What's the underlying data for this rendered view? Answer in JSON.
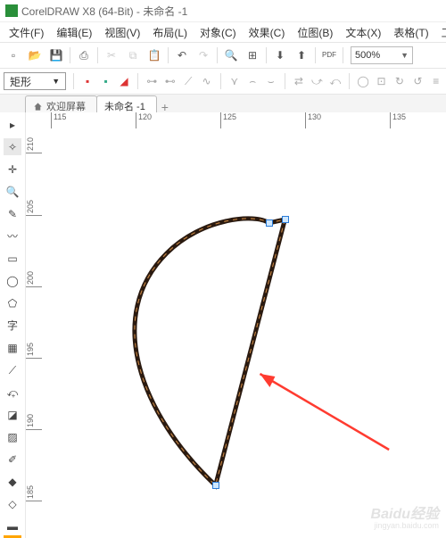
{
  "title": "CorelDRAW X8 (64-Bit) - 未命名 -1",
  "menu": {
    "file": "文件(F)",
    "edit": "编辑(E)",
    "view": "视图(V)",
    "layout": "布局(L)",
    "object": "对象(C)",
    "effect": "效果(C)",
    "bitmap": "位图(B)",
    "text": "文本(X)",
    "table": "表格(T)",
    "tool": "工"
  },
  "zoom": "500%",
  "shape_tool": "矩形",
  "tabs": {
    "welcome": "欢迎屏幕",
    "doc": "未命名 -1"
  },
  "ruler_h": [
    "115",
    "120",
    "125",
    "130",
    "135"
  ],
  "ruler_v": [
    "210",
    "205",
    "200",
    "195",
    "190",
    "185"
  ],
  "toolbar1_icons": [
    "new",
    "open",
    "save",
    "print",
    "cut",
    "copy",
    "paste",
    "undo",
    "redo",
    "search",
    "launch",
    "import",
    "export",
    "pdf"
  ],
  "toolbar2_icons": [
    "align1",
    "align2",
    "sharp",
    "node-add",
    "node-del",
    "reverse",
    "smooth",
    "break",
    "join",
    "symm",
    "cusp",
    "center",
    "line",
    "curve",
    "c-cw",
    "c-ccw",
    "close"
  ],
  "toolbox": [
    "pick",
    "shape",
    "crop",
    "zoom",
    "freehand",
    "artistic",
    "rectangle",
    "ellipse",
    "polygon",
    "text",
    "table",
    "dimension",
    "connector",
    "dropshadow",
    "transparency",
    "eyedropper",
    "fill",
    "outline",
    "interactive"
  ],
  "watermark": {
    "brand": "Baidu经验",
    "url": "jingyan.baidu.com"
  }
}
